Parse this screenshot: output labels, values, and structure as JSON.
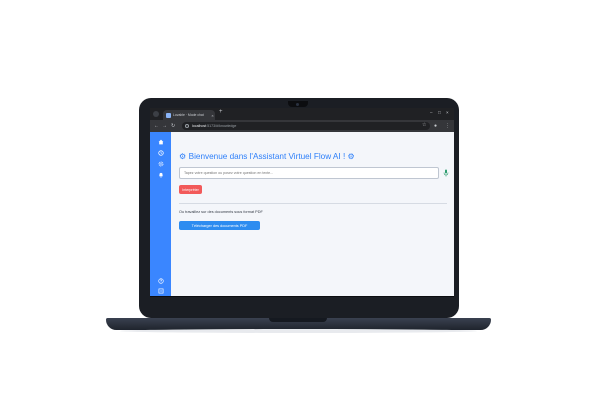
{
  "browser": {
    "tab_title": "Lovable · Mode chat",
    "tab_close": "×",
    "new_tab": "+",
    "url_host": "localhost",
    "url_path": ":5173/#/knowledge",
    "window_controls": [
      "–",
      "□",
      "×"
    ]
  },
  "sidebar": {
    "items": [
      {
        "icon": "home-icon"
      },
      {
        "icon": "history-icon"
      },
      {
        "icon": "settings-gear-icon"
      },
      {
        "icon": "notification-bell-icon"
      }
    ],
    "bottom_items": [
      {
        "icon": "help-circle-icon"
      },
      {
        "icon": "logout-icon"
      }
    ],
    "color": "#3a86ff"
  },
  "main": {
    "title": "⚙ Bienvenue dans l'Assistant Virtuel Flow AI ! ⚙",
    "question_placeholder": "Tapez votre question ou posez votre question en texte...",
    "submit_label": "Interpréter",
    "upload_label": "Ou travaillez sur des documents sous format PDF",
    "upload_button": "Télécharger des documents PDF"
  },
  "colors": {
    "accent": "#2d7ff9",
    "submit": "#f25a5a",
    "upload_button": "#2d8cf0",
    "background": "#f4f6fa"
  }
}
